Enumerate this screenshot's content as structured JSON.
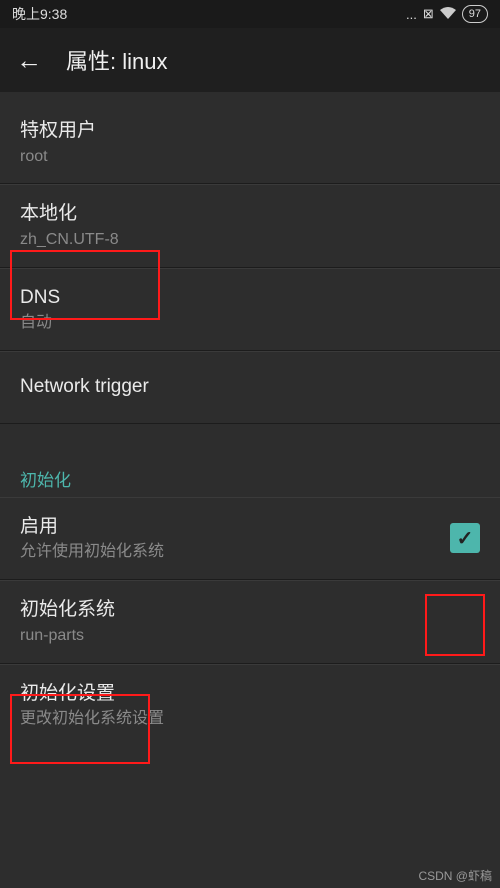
{
  "status": {
    "time": "晚上9:38",
    "dots": "...",
    "close_icon": "⊠",
    "wifi_icon": "full",
    "battery": "97"
  },
  "header": {
    "title": "属性: linux"
  },
  "items": {
    "priv_user": {
      "title": "特权用户",
      "sub": "root"
    },
    "locale": {
      "title": "本地化",
      "sub": "zh_CN.UTF-8"
    },
    "dns": {
      "title": "DNS",
      "sub": "自动"
    },
    "net_trig": {
      "title": "Network trigger"
    }
  },
  "init_section": {
    "header": "初始化",
    "enable": {
      "title": "启用",
      "sub": "允许使用初始化系统",
      "checked": true
    },
    "system": {
      "title": "初始化系统",
      "sub": "run-parts"
    },
    "settings": {
      "title": "初始化设置",
      "sub": "更改初始化系统设置"
    }
  },
  "watermark": "CSDN @虾稿"
}
